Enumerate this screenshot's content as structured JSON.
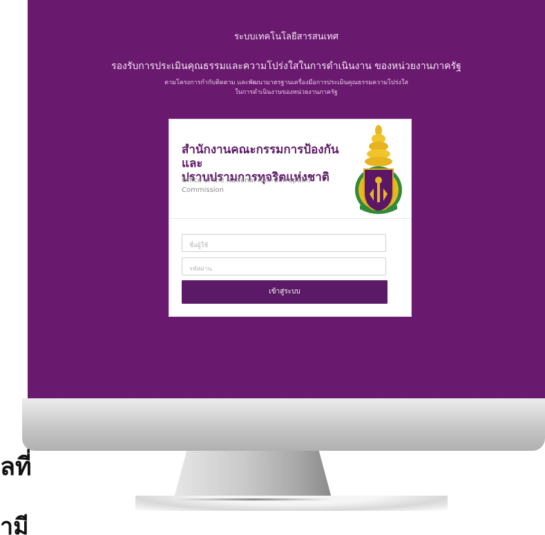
{
  "header": {
    "line1": "ระบบเทคโนโลยีสารสนเทศ",
    "line2": "รองรับการประเมินคุณธรรมและความโปร่งใสในการดำเนินงาน ของหน่วยงานภาครัฐ",
    "line3a": "ตามโครงการกำกับติดตาม และพัฒนามาตรฐานเครื่องมือการประเมินคุณธรรมความโปร่งใส",
    "line3b": "ในการดำเนินงานของหน่วยงานภาครัฐ"
  },
  "card": {
    "org_thai_1": "สำนักงานคณะกรรมการป้องกันและ",
    "org_thai_2": "ปราบปรามการทุจริตแห่งชาติ",
    "org_eng": "Office of the National Anti-Corruption Commission",
    "username_placeholder": "ชื่อผู้ใช้",
    "password_placeholder": "รหัสผ่าน",
    "login_label": "เข้าสู่ระบบ"
  },
  "overlay_text": {
    "fragment1": "ลที่",
    "fragment2": "ามี"
  },
  "colors": {
    "screen_bg": "#6a1a6e",
    "button_bg": "#5a1a65",
    "org_title": "#5c1a66"
  },
  "icons": {
    "emblem": "nacc-emblem-icon"
  }
}
